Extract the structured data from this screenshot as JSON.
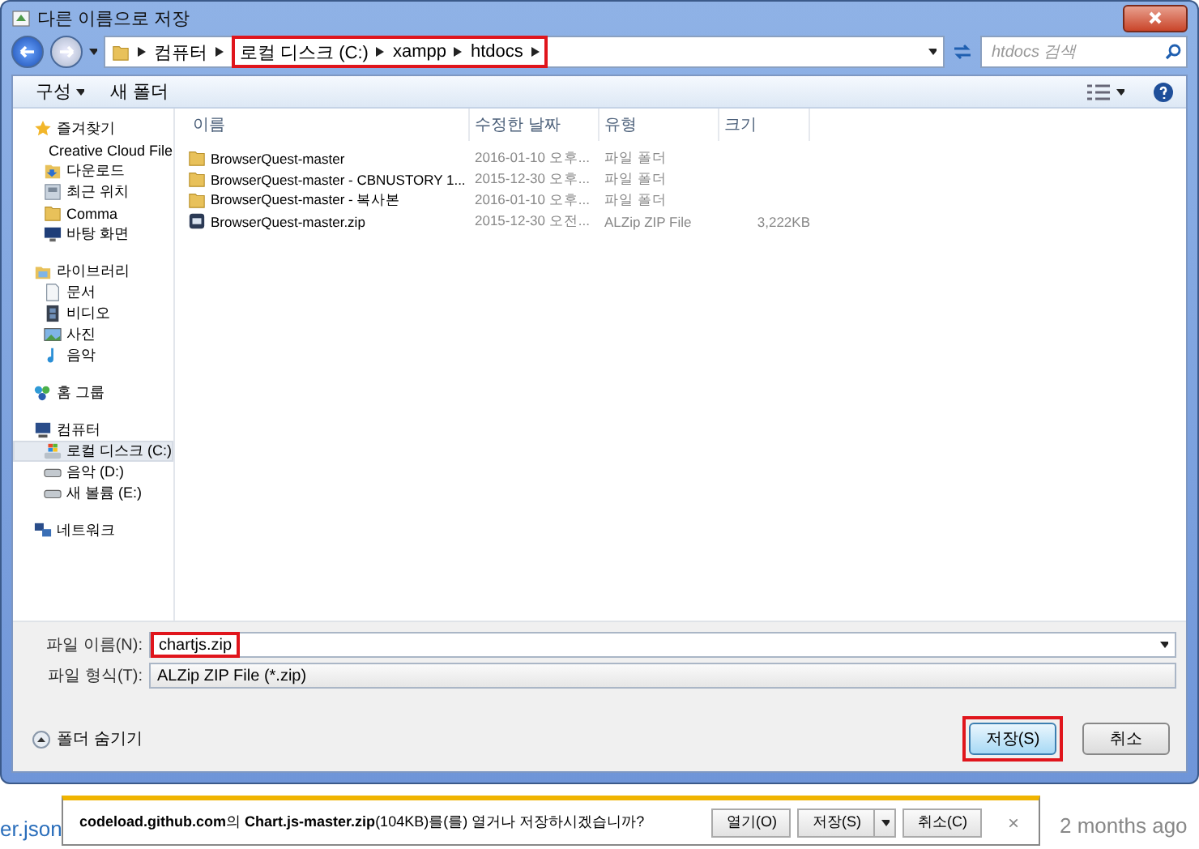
{
  "window": {
    "title": "다른 이름으로 저장"
  },
  "address": {
    "crumbs": [
      "컴퓨터"
    ],
    "marked": {
      "highlighted": true,
      "crumbs": [
        "로컬 디스크 (C:)",
        "xampp",
        "htdocs"
      ]
    }
  },
  "search": {
    "placeholder": "htdocs 검색"
  },
  "toolbar": {
    "organize": "구성",
    "new_folder": "새 폴더"
  },
  "sidebar": {
    "groups": [
      {
        "label": "즐겨찾기",
        "kind": "star",
        "children": [
          {
            "label": "Creative Cloud File",
            "kind": "folder",
            "selected": false
          },
          {
            "label": "다운로드",
            "kind": "download",
            "selected": false
          },
          {
            "label": "최근 위치",
            "kind": "recent",
            "selected": false
          },
          {
            "label": "Comma",
            "kind": "folder",
            "selected": false
          },
          {
            "label": "바탕 화면",
            "kind": "monitor",
            "selected": false
          }
        ]
      },
      {
        "label": "라이브러리",
        "kind": "library",
        "children": [
          {
            "label": "문서",
            "kind": "doc",
            "selected": false
          },
          {
            "label": "비디오",
            "kind": "video",
            "selected": false
          },
          {
            "label": "사진",
            "kind": "photo",
            "selected": false
          },
          {
            "label": "음악",
            "kind": "music",
            "selected": false
          }
        ]
      },
      {
        "label": "홈 그룹",
        "kind": "homegroup"
      },
      {
        "label": "컴퓨터",
        "kind": "computer",
        "children": [
          {
            "label": "로컬 디스크 (C:)",
            "kind": "windrive",
            "selected": true
          },
          {
            "label": "음악 (D:)",
            "kind": "drive",
            "selected": false
          },
          {
            "label": "새 볼륨 (E:)",
            "kind": "drive",
            "selected": false
          }
        ]
      },
      {
        "label": "네트워크",
        "kind": "network"
      }
    ]
  },
  "columns": [
    "이름",
    "수정한 날짜",
    "유형",
    "크기"
  ],
  "files": [
    {
      "name": "BrowserQuest-master",
      "date": "2016-01-10 오후...",
      "type": "파일 폴더",
      "kind": "folder"
    },
    {
      "name": "BrowserQuest-master - CBNUSTORY 1...",
      "date": "2015-12-30 오후...",
      "type": "파일 폴더",
      "kind": "folder"
    },
    {
      "name": "BrowserQuest-master - 복사본",
      "date": "2016-01-10 오후...",
      "type": "파일 폴더",
      "kind": "folder"
    },
    {
      "name": "BrowserQuest-master.zip",
      "date": "2015-12-30 오전...",
      "type": "ALZip ZIP File",
      "size": "3,222KB",
      "kind": "zip"
    }
  ],
  "filename": {
    "label": "파일 이름(N):",
    "value": "chartjs.zip",
    "highlighted": true
  },
  "filetype": {
    "label": "파일 형식(T):",
    "value": "ALZip ZIP File (*.zip)"
  },
  "hide_folders": "폴더 숨기기",
  "buttons": [
    {
      "label": "저장(S)",
      "highlighted": true,
      "default": true
    },
    {
      "label": "취소",
      "highlighted": false,
      "default": false
    }
  ],
  "background": {
    "file": "er.json",
    "time": "2 months ago"
  },
  "download_bar": {
    "message": "**codeload.github.com**의 **Chart.js-master.zip**(104KB)를(를) 열거나 저장하시겠습니까?",
    "open": "열기(O)",
    "save": "저장(S)",
    "cancel": "취소(C)",
    "close": "×"
  }
}
